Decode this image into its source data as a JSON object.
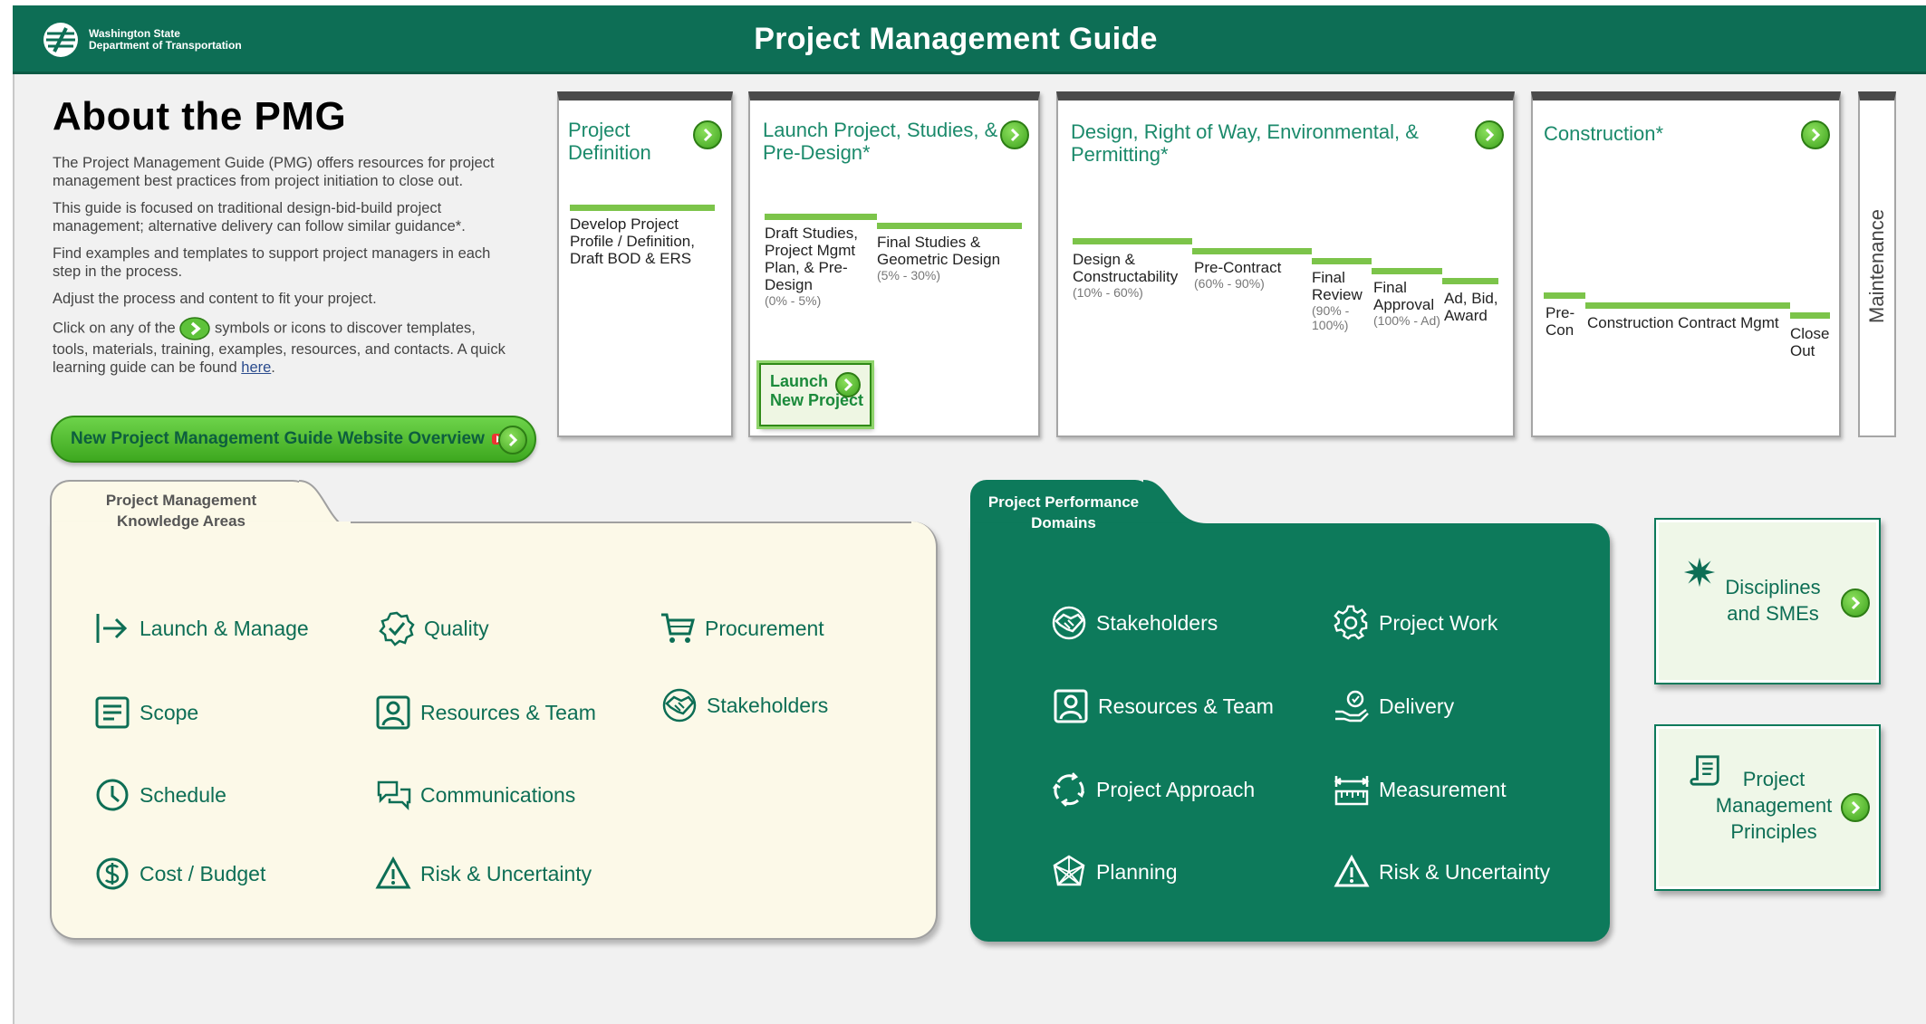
{
  "header": {
    "org_line1": "Washington State",
    "org_line2": "Department of Transportation",
    "title": "Project Management Guide"
  },
  "about": {
    "title": "About the PMG",
    "p1": "The Project Management Guide (PMG) offers resources for project management best practices from project initiation to close out.",
    "p2": "This guide is focused on traditional design-bid-build project management; alternative delivery can follow similar guidance*.",
    "p3": "Find examples and templates to support project managers in each step in the process.",
    "p4": "Adjust the process and content to fit your project.",
    "p5_before": "Click on any of the",
    "p5_after": "symbols or icons to discover templates, tools, materials, training, examples, resources, and contacts. A quick learning guide can be found",
    "p5_link": "here",
    "p5_end": ".",
    "overview_button": "New Project Management Guide Website Overview"
  },
  "phases": {
    "definition": {
      "title": "Project Definition",
      "step1": "Develop Project Profile / Definition, Draft BOD & ERS"
    },
    "launch": {
      "title": "Launch Project, Studies, & Pre-Design*",
      "step1": "Draft Studies, Project Mgmt Plan, & Pre-Design",
      "step1_pct": "(0% - 5%)",
      "step2": "Final Studies & Geometric Design",
      "step2_pct": "(5% - 30%)",
      "launch_button_line1": "Launch",
      "launch_button_line2": "New Project"
    },
    "design": {
      "title": "Design, Right of Way, Environmental, & Permitting*",
      "step1": "Design & Constructability",
      "step1_pct": "(10% - 60%)",
      "step2": "Pre-Contract",
      "step2_pct": "(60% - 90%)",
      "step3": "Final Review",
      "step3_pct": "(90% - 100%)",
      "step4": "Final Approval",
      "step4_pct": "(100% - Ad)",
      "step5": "Ad, Bid, Award"
    },
    "construction": {
      "title": "Construction*",
      "step1": "Pre-Con",
      "step2": "Construction Contract Mgmt",
      "step3": "Close Out"
    },
    "maintenance": "Maintenance"
  },
  "knowledge_areas": {
    "tab_label_line1": "Project Management",
    "tab_label_line2": "Knowledge Areas",
    "items": {
      "launch_manage": "Launch & Manage",
      "quality": "Quality",
      "procurement": "Procurement",
      "scope": "Scope",
      "resources_team": "Resources & Team",
      "stakeholders": "Stakeholders",
      "schedule": "Schedule",
      "communications": "Communications",
      "cost_budget": "Cost / Budget",
      "risk": "Risk & Uncertainty"
    }
  },
  "performance_domains": {
    "tab_label_line1": "Project Performance",
    "tab_label_line2": "Domains",
    "items": {
      "stakeholders": "Stakeholders",
      "project_work": "Project Work",
      "resources_team": "Resources & Team",
      "delivery": "Delivery",
      "project_approach": "Project Approach",
      "measurement": "Measurement",
      "planning": "Planning",
      "risk": "Risk & Uncertainty"
    }
  },
  "side_boxes": {
    "disciplines_line1": "Disciplines",
    "disciplines_line2": "and SMEs",
    "principles_line1": "Project",
    "principles_line2": "Management",
    "principles_line3": "Principles"
  },
  "colors": {
    "brand_green": "#0d6e55",
    "accent_green": "#7cc44a",
    "cream": "#fcf9e8"
  }
}
